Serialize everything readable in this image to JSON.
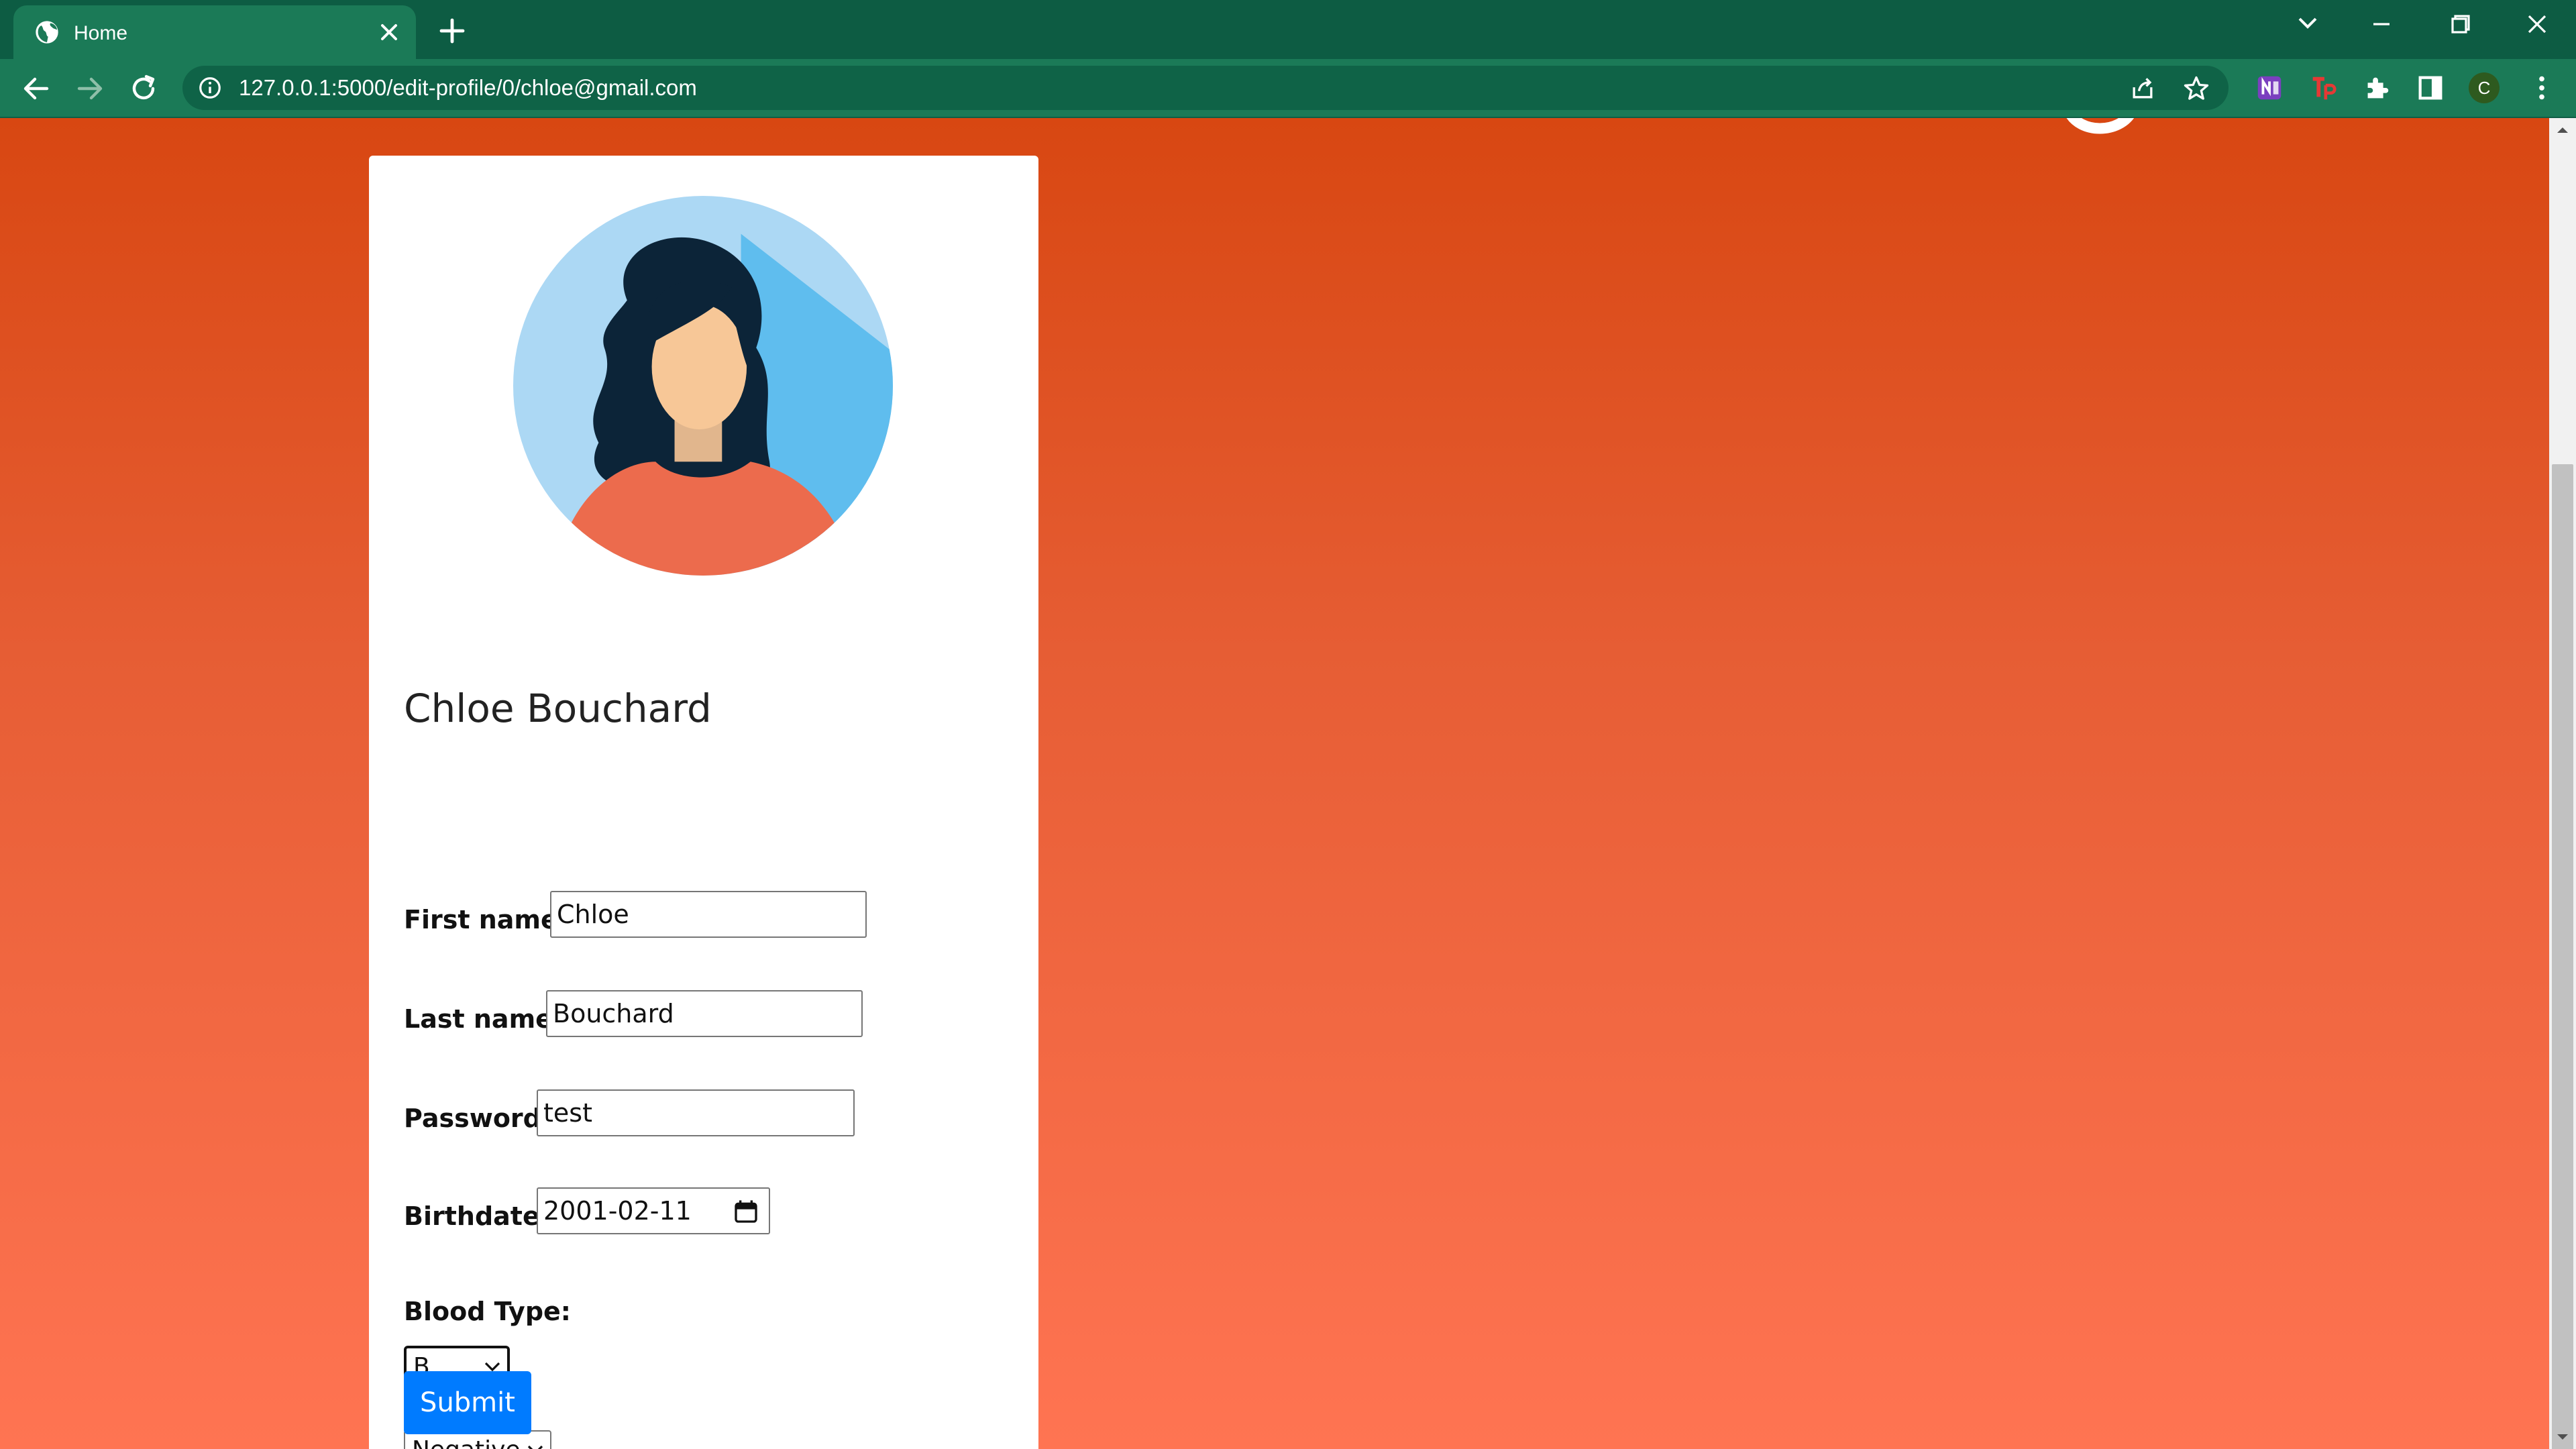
{
  "browser": {
    "tab": {
      "title": "Home",
      "icon": "globe-icon"
    },
    "address_bar": {
      "url": "127.0.0.1:5000/edit-profile/0/chloe@gmail.com"
    },
    "profile_initial": "C",
    "colors": {
      "tab_strip": "#0d5c43",
      "toolbar": "#1b7a57",
      "page_gradient_top": "#d84712",
      "page_gradient_bottom": "#ff7452"
    }
  },
  "profile": {
    "avatar": "woman-avatar-illustration",
    "name": "Chloe Bouchard"
  },
  "form": {
    "first_name": {
      "label": "First name:",
      "value": "Chloe"
    },
    "last_name": {
      "label": "Last name:",
      "value": "Bouchard"
    },
    "password": {
      "label": "Password:",
      "value": "test"
    },
    "birthdate": {
      "label": "Birthdate:",
      "value": "2001-02-11"
    },
    "blood_type": {
      "label": "Blood Type:",
      "group_value": "B",
      "rh_value": "Negative"
    },
    "submit_label": "Submit",
    "submit_color": "#007bff"
  }
}
